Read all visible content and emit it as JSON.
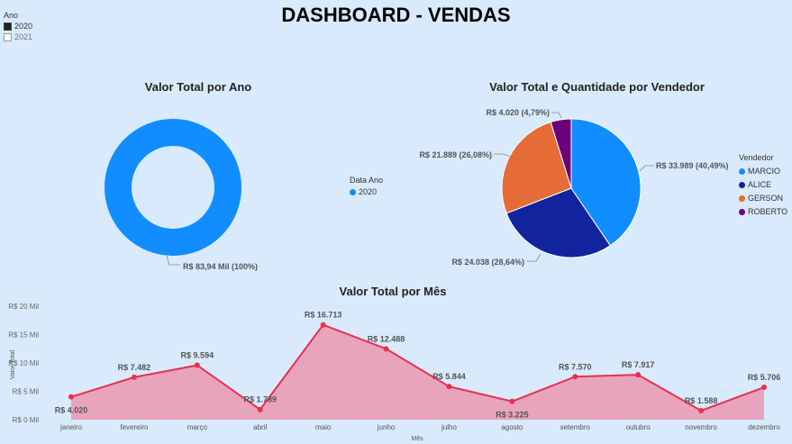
{
  "header": {
    "title": "DASHBOARD - VENDAS"
  },
  "slicer": {
    "title": "Ano",
    "items": [
      {
        "label": "2020",
        "selected": true
      },
      {
        "label": "2021",
        "selected": false
      }
    ]
  },
  "colors": {
    "background": "#d8eafb",
    "blue": "#118dff",
    "navy": "#12239e",
    "orange": "#e66c37",
    "purple": "#6b007b",
    "line": "#e8304f",
    "area": "#e8a0b8"
  },
  "chart_data": [
    {
      "type": "donut",
      "title": "Valor Total por Ano",
      "legend_title": "Data Ano",
      "categories": [
        "2020"
      ],
      "values": [
        83.94
      ],
      "data_labels": [
        "R$ 83,94 Mil (100%)"
      ],
      "colors": [
        "#118dff"
      ]
    },
    {
      "type": "pie",
      "title": "Valor Total e Quantidade por Vendedor",
      "legend_title": "Vendedor",
      "legend_position": "right",
      "categories": [
        "MARCIO",
        "ALICE",
        "GERSON",
        "ROBERTO"
      ],
      "values": [
        33989,
        24038,
        21889,
        4020
      ],
      "data_labels": [
        "R$ 33.989 (40,49%)",
        "R$ 24.038 (28,64%)",
        "R$ 21.889 (26,08%)",
        "R$ 4.020 (4,79%)"
      ],
      "colors": [
        "#118dff",
        "#12239e",
        "#e66c37",
        "#6b007b"
      ]
    },
    {
      "type": "area",
      "title": "Valor Total por Mês",
      "xlabel": "Mês",
      "ylabel": "Valor Total",
      "ylim": [
        0,
        20
      ],
      "yticks": [
        "R$ 0 Mil",
        "R$ 5 Mil",
        "R$ 10 Mil",
        "R$ 15 Mil",
        "R$ 20 Mil"
      ],
      "categories": [
        "janeiro",
        "fevereiro",
        "março",
        "abril",
        "maio",
        "junho",
        "julho",
        "agosto",
        "setembro",
        "outubro",
        "novembro",
        "dezembro"
      ],
      "values": [
        4.02,
        7.482,
        9.594,
        1.789,
        16.713,
        12.488,
        5.844,
        3.225,
        7.57,
        7.917,
        1.588,
        5.706
      ],
      "data_labels": [
        "R$ 4.020",
        "R$ 7.482",
        "R$ 9.594",
        "R$ 1.789",
        "R$ 16.713",
        "R$ 12.488",
        "R$ 5.844",
        "R$ 3.225",
        "R$ 7.570",
        "R$ 7.917",
        "R$ 1.588",
        "R$ 5.706"
      ],
      "grid": true
    }
  ]
}
